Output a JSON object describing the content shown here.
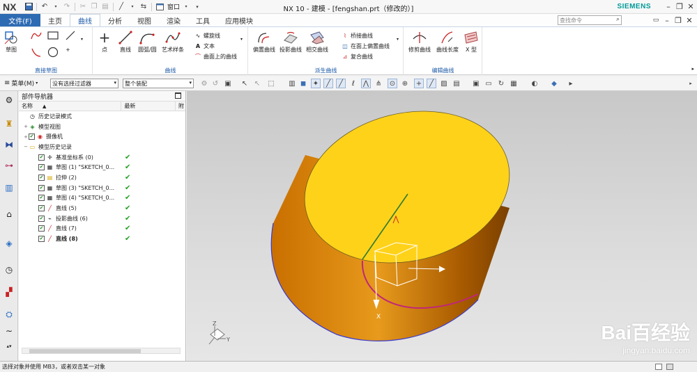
{
  "app": {
    "logo": "NX",
    "title": "NX 10 - 建模 - [fengshan.prt（修改的）]",
    "brand": "SIEMENS",
    "window_menu": "窗口"
  },
  "tabs": {
    "file": "文件(F)",
    "items": [
      "主页",
      "曲线",
      "分析",
      "视图",
      "渲染",
      "工具",
      "应用模块"
    ],
    "active": "曲线"
  },
  "search": {
    "placeholder": "查找命令"
  },
  "ribbon": {
    "direct_sketch": {
      "label": "直接草图",
      "sketch": "草图"
    },
    "curve": {
      "label": "曲线",
      "point": "点",
      "line": "直线",
      "arc": "圆弧/圆",
      "studio_spline": "艺术样条",
      "helix": "螺旋线",
      "text": "文本",
      "curve_on_surface": "曲面上的曲线"
    },
    "derived": {
      "label": "派生曲线",
      "offset": "偏置曲线",
      "project": "投影曲线",
      "intersect": "相交曲线",
      "bridge": "桥接曲线",
      "offset_in_face": "在面上偏置曲线",
      "composite": "复合曲线"
    },
    "edit": {
      "label": "编辑曲线",
      "trim": "修剪曲线",
      "length": "曲线长度",
      "x_form": "X 型"
    }
  },
  "selection": {
    "menu": "菜单(M)",
    "filter": "没有选择过滤器",
    "scope": "整个装配"
  },
  "navigator": {
    "title": "部件导航器",
    "columns": {
      "name": "名称",
      "latest": "最新",
      "extra": "附"
    },
    "rows": [
      {
        "name": "历史记录模式",
        "indent": 0,
        "exp": "",
        "check": false,
        "icon": "clock-icon",
        "latest": false,
        "bold": false
      },
      {
        "name": "模型视图",
        "indent": 0,
        "exp": "+",
        "check": false,
        "icon": "model-views-icon",
        "latest": false,
        "bold": false
      },
      {
        "name": "摄像机",
        "indent": 0,
        "exp": "+",
        "check": true,
        "icon": "camera-icon",
        "latest": false,
        "bold": false
      },
      {
        "name": "模型历史记录",
        "indent": 0,
        "exp": "−",
        "check": false,
        "icon": "folder-icon",
        "latest": false,
        "bold": false
      },
      {
        "name": "基准坐标系 (0)",
        "indent": 1,
        "exp": "",
        "check": true,
        "icon": "datum-csys-icon",
        "latest": true,
        "bold": false
      },
      {
        "name": "草图 (1) \"SKETCH_0...",
        "indent": 1,
        "exp": "",
        "check": true,
        "icon": "sketch-icon",
        "latest": true,
        "bold": false
      },
      {
        "name": "拉伸 (2)",
        "indent": 1,
        "exp": "",
        "check": true,
        "icon": "extrude-icon",
        "latest": true,
        "bold": false
      },
      {
        "name": "草图 (3) \"SKETCH_0...",
        "indent": 1,
        "exp": "",
        "check": true,
        "icon": "sketch-icon",
        "latest": true,
        "bold": false
      },
      {
        "name": "草图 (4) \"SKETCH_0...",
        "indent": 1,
        "exp": "",
        "check": true,
        "icon": "sketch-icon",
        "latest": true,
        "bold": false
      },
      {
        "name": "直线 (5)",
        "indent": 1,
        "exp": "",
        "check": true,
        "icon": "line-icon",
        "latest": true,
        "bold": false
      },
      {
        "name": "投影曲线 (6)",
        "indent": 1,
        "exp": "",
        "check": true,
        "icon": "project-curve-icon",
        "latest": true,
        "bold": false
      },
      {
        "name": "直线 (7)",
        "indent": 1,
        "exp": "",
        "check": true,
        "icon": "line-icon",
        "latest": true,
        "bold": false
      },
      {
        "name": "直线 (8)",
        "indent": 1,
        "exp": "",
        "check": true,
        "icon": "line-icon",
        "latest": true,
        "bold": true
      }
    ]
  },
  "viewport": {
    "axis_x": "X",
    "triad_z": "Z",
    "triad_y": "Y",
    "watermark_main": "Bai百经验",
    "watermark_sub": "jingyan.baidu.com"
  },
  "status": {
    "text": "选择对象并使用 MB3，或者双击某一对象"
  },
  "colors": {
    "file_tab": "#2e6bb3",
    "cylinder_top": "#ffd21a",
    "cylinder_side": "#d98a00",
    "projected_curve": "#c0267a",
    "line": "#2f7a2f",
    "brand": "#009999"
  }
}
